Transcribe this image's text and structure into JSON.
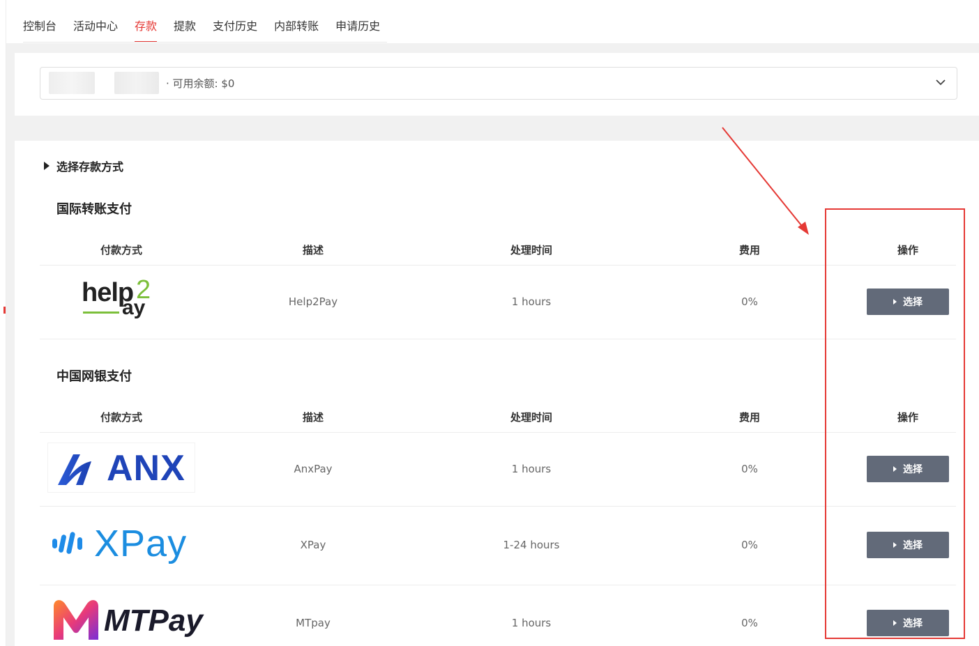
{
  "tabs": [
    {
      "label": "控制台"
    },
    {
      "label": "活动中心"
    },
    {
      "label": "存款"
    },
    {
      "label": "提款"
    },
    {
      "label": "支付历史"
    },
    {
      "label": "内部转账"
    },
    {
      "label": "申请历史"
    }
  ],
  "active_tab": "存款",
  "account": {
    "balance_label": "· 可用余额: $0"
  },
  "section": {
    "toggle_label": "选择存款方式"
  },
  "columns": {
    "method": "付款方式",
    "description": "描述",
    "processing_time": "处理时间",
    "fee": "费用",
    "action": "操作"
  },
  "groups": [
    {
      "title": "国际转账支付",
      "rows": [
        {
          "logo": "help2pay-logo",
          "logo_text_a": "help",
          "logo_text_b": "2",
          "logo_text_c": "ay",
          "description": "Help2Pay",
          "time": "1 hours",
          "fee": "0%",
          "button": "选择"
        }
      ]
    },
    {
      "title": "中国网银支付",
      "rows": [
        {
          "logo": "anx-logo",
          "logo_text": "ANX",
          "description": "AnxPay",
          "time": "1 hours",
          "fee": "0%",
          "button": "选择"
        },
        {
          "logo": "xpay-logo",
          "logo_text": "XPay",
          "description": "XPay",
          "time": "1-24 hours",
          "fee": "0%",
          "button": "选择"
        },
        {
          "logo": "mtpay-logo",
          "logo_text": "MTPay",
          "description": "MTpay",
          "time": "1 hours",
          "fee": "0%",
          "button": "选择"
        }
      ]
    }
  ],
  "colors": {
    "accent": "#e53935",
    "button": "#626a79",
    "annotation": "#e53935"
  }
}
